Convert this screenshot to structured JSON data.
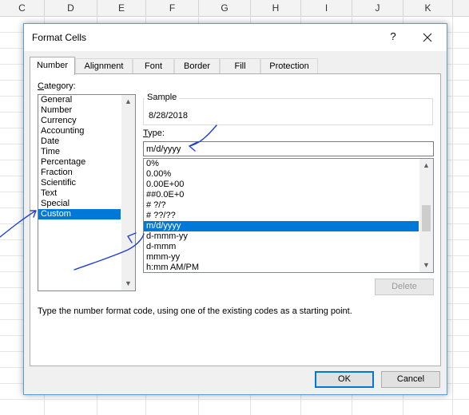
{
  "spreadsheet": {
    "columns": [
      "C",
      "D",
      "E",
      "F",
      "G",
      "H",
      "I",
      "J",
      "K"
    ]
  },
  "dialog": {
    "title": "Format Cells",
    "help_label": "?",
    "tabs": [
      "Number",
      "Alignment",
      "Font",
      "Border",
      "Fill",
      "Protection"
    ],
    "active_tab": "Number",
    "category": {
      "label_accel": "C",
      "label_rest": "ategory:",
      "items": [
        "General",
        "Number",
        "Currency",
        "Accounting",
        "Date",
        "Time",
        "Percentage",
        "Fraction",
        "Scientific",
        "Text",
        "Special",
        "Custom"
      ],
      "selected": "Custom"
    },
    "sample": {
      "label": "Sample",
      "value": "8/28/2018"
    },
    "type": {
      "label_accel": "T",
      "label_rest": "ype:",
      "value": "m/d/yyyy",
      "formats": [
        "0%",
        "0.00%",
        "0.00E+00",
        "##0.0E+0",
        "# ?/?",
        "# ??/??",
        "m/d/yyyy",
        "d-mmm-yy",
        "d-mmm",
        "mmm-yy",
        "h:mm AM/PM"
      ],
      "selected": "m/d/yyyy"
    },
    "delete_label": "Delete",
    "hint": "Type the number format code, using one of the existing codes as a starting point.",
    "ok_label": "OK",
    "cancel_label": "Cancel"
  },
  "colors": {
    "accent": "#0078d7",
    "annotation_ink": "#1f3fd6"
  }
}
